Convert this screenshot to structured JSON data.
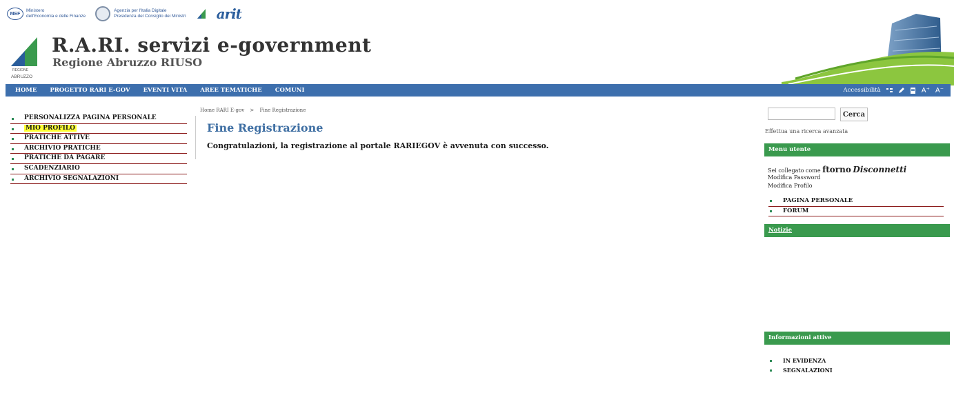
{
  "top_logos": {
    "mef_badge": "MEF",
    "mef_line1": "Ministero",
    "mef_line2": "dell'Economia e delle Finanze",
    "agid_line1": "Agenzia per l'Italia Digitale",
    "agid_line2": "Presidenza del Consiglio dei Ministri",
    "arit": "arit"
  },
  "header": {
    "title": "R.A.RI. servizi e-government",
    "subtitle": "Regione Abruzzo RIUSO",
    "logo_caption1": "REGIONE",
    "logo_caption2": "ABRUZZO"
  },
  "nav": {
    "items": [
      "HOME",
      "PROGETTO RARI E-GOV",
      "EVENTI VITA",
      "AREE TEMATICHE",
      "COMUNI"
    ],
    "accessibility": "Accessibilità",
    "font_increase": "A⁺",
    "font_decrease": "A⁻"
  },
  "left_menu": {
    "items": [
      "PERSONALIZZA PAGINA PERSONALE",
      "MIO PROFILO",
      "PRATICHE ATTIVE",
      "ARCHIVIO PRATICHE",
      "PRATICHE DA PAGARE",
      "SCADENZIARIO",
      "ARCHIVIO SEGNALAZIONI"
    ]
  },
  "content": {
    "breadcrumb_home": "Home RARI E-gov",
    "breadcrumb_sep": ">",
    "breadcrumb_current": "Fine Registrazione",
    "title": "Fine Registrazione",
    "message": "Congratulazioni, la registrazione al portale RARIEGOV è avvenuta con successo."
  },
  "sidebar": {
    "search_button": "Cerca",
    "search_value": "",
    "advanced_search": "Effettua una ricerca avanzata",
    "menu_utente_title": "Menu utente",
    "logged_as": "Sei collegato come ",
    "username": "ftorno",
    "disconnect": "Disconnetti",
    "change_password": "Modifica Password",
    "edit_profile": "Modifica Profilo",
    "user_links": [
      "PAGINA PERSONALE",
      "FORUM"
    ],
    "notizie_title": "Notizie",
    "info_title": "Informazioni attive",
    "info_links": [
      "IN EVIDENZA",
      "SEGNALAZIONI"
    ]
  },
  "colors": {
    "nav_blue": "#3d6fad",
    "panel_green": "#3a9a4e",
    "title_blue": "#3f6fa3",
    "divider_red": "#8b1a1a",
    "highlight": "#ffff33"
  }
}
